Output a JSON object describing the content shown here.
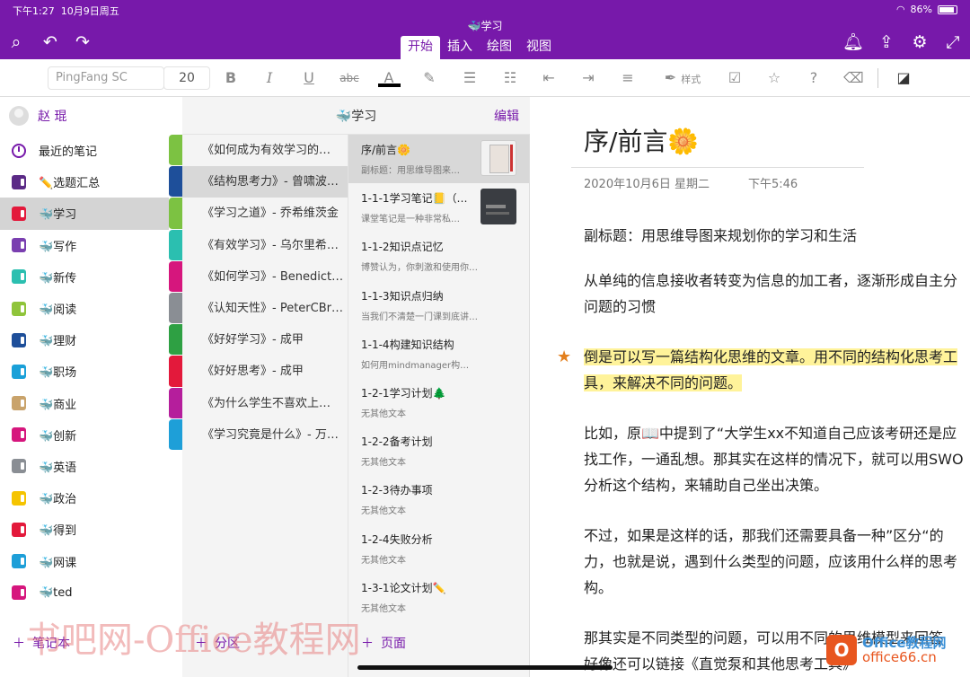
{
  "status": {
    "time": "下午1:27",
    "date": "10月9日周五",
    "battery": "86%"
  },
  "header": {
    "title": "🐳学习",
    "tabs": [
      "开始",
      "插入",
      "绘图",
      "视图"
    ]
  },
  "ribbon": {
    "font": "PingFang SC",
    "size": "20",
    "bold": "B",
    "italic": "I",
    "underline": "U",
    "strike": "abc",
    "fontcolor": "A",
    "style_label": "样式"
  },
  "sidebar": {
    "user": "赵 琨",
    "items": [
      {
        "label": "最近的笔记",
        "icon": "recent-icon",
        "color": "#7719aa"
      },
      {
        "label": "✏️选题汇总",
        "icon": "notebook-icon",
        "color": "#5b2a86"
      },
      {
        "label": "🐳学习",
        "icon": "notebook-icon",
        "color": "#e3193b"
      },
      {
        "label": "🐳写作",
        "icon": "notebook-icon",
        "color": "#7a3fb0"
      },
      {
        "label": "🐳新传",
        "icon": "notebook-icon",
        "color": "#2bbfb0"
      },
      {
        "label": "🐳阅读",
        "icon": "notebook-icon",
        "color": "#8fc43a"
      },
      {
        "label": "🐳理财",
        "icon": "notebook-icon",
        "color": "#1e4f9a"
      },
      {
        "label": "🐳职场",
        "icon": "notebook-icon",
        "color": "#1aa0d8"
      },
      {
        "label": "🐳商业",
        "icon": "notebook-icon",
        "color": "#c9a36b"
      },
      {
        "label": "🐳创新",
        "icon": "notebook-icon",
        "color": "#d6167d"
      },
      {
        "label": "🐳英语",
        "icon": "notebook-icon",
        "color": "#8a8e94"
      },
      {
        "label": "🐳政治",
        "icon": "notebook-icon",
        "color": "#f5c400"
      },
      {
        "label": "🐳得到",
        "icon": "notebook-icon",
        "color": "#e3193b"
      },
      {
        "label": "🐳网课",
        "icon": "notebook-icon",
        "color": "#1e9fd8"
      },
      {
        "label": "🐳ted",
        "icon": "notebook-icon",
        "color": "#d6167d"
      }
    ],
    "add_label": "笔记本"
  },
  "sections": {
    "title": "🐳学习",
    "edit": "编辑",
    "tab_colors": [
      "#7cc242",
      "#1e4f9a",
      "#7cc242",
      "#2bbfb0",
      "#d6167d",
      "#8a8e94",
      "#2ea043",
      "#e3193b",
      "#b51e9c",
      "#1e9fd8"
    ],
    "items": [
      "《如何成为有效学习的…",
      "《结构思考力》- 曾啸波…",
      "《学习之道》- 乔希维茨金",
      "《有效学习》- 乌尔里希…",
      "《如何学习》- Benedict…",
      "《认知天性》- PeterCBr…",
      "《好好学习》- 成甲",
      "《好好思考》- 成甲",
      "《为什么学生不喜欢上…",
      "《学习究竟是什么》- 万…"
    ],
    "add_label": "分区"
  },
  "pages": {
    "items": [
      {
        "title": "序/前言🌼",
        "sub": "副标题：用思维导图来…",
        "thumb": "book"
      },
      {
        "title": "1-1-1学习笔记📒（…",
        "sub": "课堂笔记是一种非常私…",
        "thumb": "dark"
      },
      {
        "title": "1-1-2知识点记忆",
        "sub": "博赞认为，你刺激和使用你的想…",
        "thumb": ""
      },
      {
        "title": "1-1-3知识点归纳",
        "sub": "当我们不清楚一门课到底讲了什…",
        "thumb": ""
      },
      {
        "title": "1-1-4构建知识结构",
        "sub": "如何用mindmanager构建自己的…",
        "thumb": ""
      },
      {
        "title": "1-2-1学习计划🌲",
        "sub": "无其他文本",
        "thumb": ""
      },
      {
        "title": "1-2-2备考计划",
        "sub": "无其他文本",
        "thumb": ""
      },
      {
        "title": "1-2-3待办事项",
        "sub": "无其他文本",
        "thumb": ""
      },
      {
        "title": "1-2-4失败分析",
        "sub": "无其他文本",
        "thumb": ""
      },
      {
        "title": "1-3-1论文计划✏️",
        "sub": "无其他文本",
        "thumb": ""
      }
    ],
    "add_label": "页面"
  },
  "content": {
    "title": "序/前言🌼",
    "date": "2020年10月6日 星期二",
    "time": "下午5:46",
    "p1": "副标题：用思维导图来规划你的学习和生活",
    "p2a": "从单纯的信息接收者转变为信息的加工者，逐渐形成自主分",
    "p2b": "问题的习惯",
    "p3a": "倒是可以写一篇结构化思维的文章。用不同的结构化思考工",
    "p3b": "具，来解决不同的问题。",
    "p4a": "比如，原📖中提到了“大学生xx不知道自己应该考研还是应",
    "p4b": "找工作，一通乱想。那其实在这样的情况下，就可以用SWO",
    "p4c": "分析这个结构，来辅助自己坐出决策。",
    "p5a": "不过，如果是这样的话，那我们还需要具备一种”区分“的",
    "p5b": "力，也就是说，遇到什么类型的问题，应该用什么样的思考",
    "p5c": "构。",
    "p6a": "那其实是不同类型的问题，可以用不同的思维模型来回答",
    "p6b": "好像还可以链接《直觉泵和其他思考工具》"
  },
  "watermark": {
    "text": "书吧网-Office教程网",
    "logo_top": "Office教程网",
    "logo_bottom": "office66.cn"
  }
}
